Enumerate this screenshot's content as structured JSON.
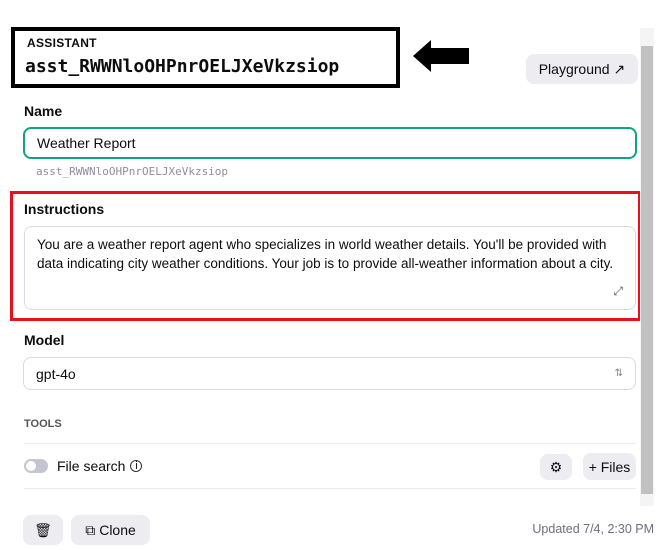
{
  "header": {
    "label": "ASSISTANT",
    "assistant_id": "asst_RWWNloOHPnrOELJXeVkzsiop",
    "playground_label": "Playground",
    "playground_icon": "arrow-up-right-icon"
  },
  "name": {
    "label": "Name",
    "value": "Weather Report",
    "id_hint": "asst_RWWNloOHPnrOELJXeVkzsiop"
  },
  "instructions": {
    "label": "Instructions",
    "value": "You are a weather report agent who specializes in world weather details.  You'll be provided with data indicating city weather conditions.  Your job is to provide all-weather information about a city."
  },
  "model": {
    "label": "Model",
    "value": "gpt-4o"
  },
  "tools": {
    "label": "TOOLS",
    "items": [
      {
        "label": "File search",
        "enabled": false,
        "files_label": "+ Files"
      }
    ]
  },
  "footer": {
    "clone_label": "Clone",
    "updated": "Updated 7/4, 2:30 PM"
  },
  "colors": {
    "accent": "#10a37f",
    "annotation_red": "#e8101c"
  }
}
